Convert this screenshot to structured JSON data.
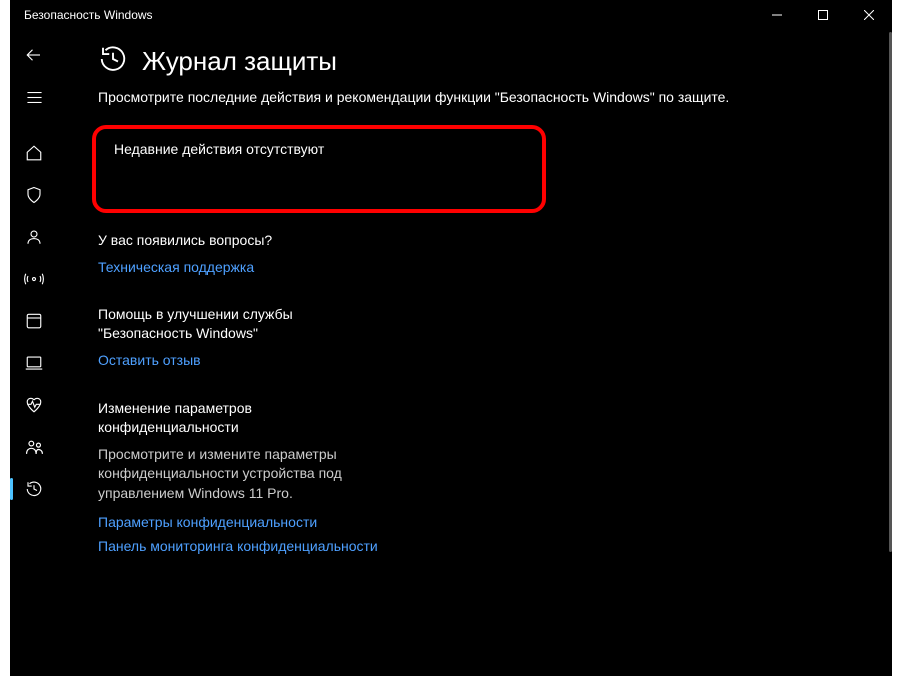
{
  "window": {
    "title": "Безопасность Windows"
  },
  "page": {
    "title": "Журнал защиты",
    "description": "Просмотрите последние действия и рекомендации функции \"Безопасность Windows\" по защите."
  },
  "highlight": {
    "message": "Недавние действия отсутствуют"
  },
  "sections": {
    "questions": {
      "heading": "У вас появились вопросы?",
      "link": "Техническая поддержка"
    },
    "feedback": {
      "heading": "Помощь в улучшении службы \"Безопасность Windows\"",
      "link": "Оставить отзыв"
    },
    "privacy": {
      "heading": "Изменение параметров конфиденциальности",
      "subtext": "Просмотрите и измените параметры конфиденциальности устройства под управлением Windows 11 Pro.",
      "link1": "Параметры конфиденциальности",
      "link2": "Панель мониторинга конфиденциальности"
    }
  },
  "sidebar": {
    "items": [
      {
        "name": "back"
      },
      {
        "name": "menu"
      },
      {
        "name": "home"
      },
      {
        "name": "shield"
      },
      {
        "name": "account"
      },
      {
        "name": "firewall"
      },
      {
        "name": "app-control"
      },
      {
        "name": "device-security"
      },
      {
        "name": "device-performance"
      },
      {
        "name": "family"
      },
      {
        "name": "history"
      }
    ]
  },
  "colors": {
    "link": "#4ea0ff",
    "accent": "#4cc2ff",
    "highlight_border": "#f00"
  }
}
